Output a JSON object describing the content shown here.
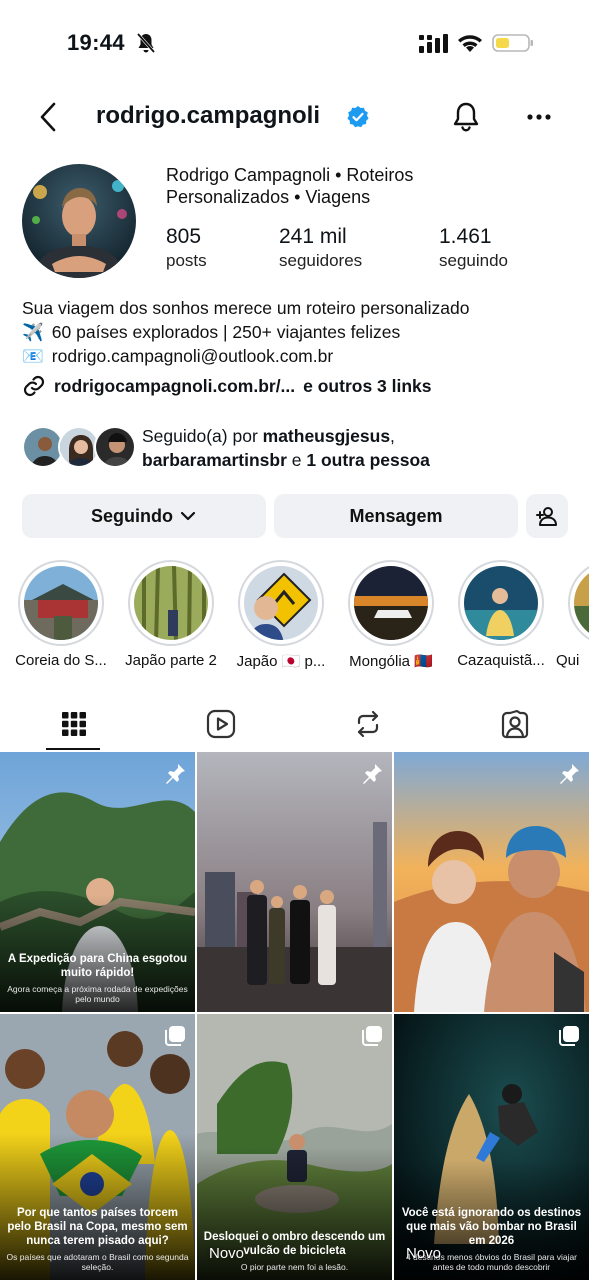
{
  "status_bar": {
    "time": "19:44"
  },
  "header": {
    "username": "rodrigo.campagnoli"
  },
  "profile": {
    "name_line1": "Rodrigo Campagnoli  • Roteiros",
    "name_line2": "Personalizados • Viagens",
    "stats": [
      {
        "value": "805",
        "label": "posts"
      },
      {
        "value": "241 mil",
        "label": "seguidores"
      },
      {
        "value": "1.461",
        "label": "seguindo"
      }
    ],
    "bio": {
      "line1": "Sua viagem dos sonhos merece um roteiro personalizado",
      "line2_emoji": "✈️",
      "line2": "60 países explorados | 250+ viajantes felizes",
      "line3_emoji": "📧",
      "line3": "rodrigo.campagnoli@outlook.com.br"
    },
    "link": {
      "text": "rodrigocampagnoli.com.br/...",
      "more": "e outros 3 links"
    },
    "followed_by": {
      "prefix": "Seguido(a) por ",
      "user1": "matheusgjesus",
      "sep": ",",
      "user2": "barbaramartinsbr",
      "mid": " e ",
      "rest": "1 outra pessoa"
    }
  },
  "actions": {
    "following_label": "Seguindo",
    "message_label": "Mensagem"
  },
  "highlights": [
    {
      "label": "Coreia do S..."
    },
    {
      "label": "Japão parte 2"
    },
    {
      "label": "Japão 🇯🇵 p..."
    },
    {
      "label": "Mongólia 🇲🇳"
    },
    {
      "label": "Cazaquistã..."
    },
    {
      "label": "Qui"
    }
  ],
  "posts": [
    {
      "caption": "A Expedição para China esgotou muito rápido!",
      "sub": "Agora começa a próxima rodada de expedições pelo mundo"
    },
    {
      "caption": "",
      "sub": ""
    },
    {
      "caption": "",
      "sub": ""
    },
    {
      "caption": "Por que tantos países torcem pelo Brasil na Copa, mesmo sem nunca terem pisado aqui?",
      "sub": "Os países que adotaram o Brasil como segunda seleção."
    },
    {
      "caption": "Desloquei o ombro descendo um vulcão de bicicleta",
      "sub": "O pior parte nem foi a lesão.",
      "badge": "Novo"
    },
    {
      "caption": "Você está ignorando os destinos que mais vão bombar no Brasil em 2026",
      "sub": "4 destinos menos óbvios do Brasil para viajar antes de todo mundo descobrir",
      "badge": "Novo"
    }
  ],
  "colors": {
    "verified": "#1d9bf0",
    "button_bg": "#eff1f4",
    "battery": "#f5d94a"
  }
}
